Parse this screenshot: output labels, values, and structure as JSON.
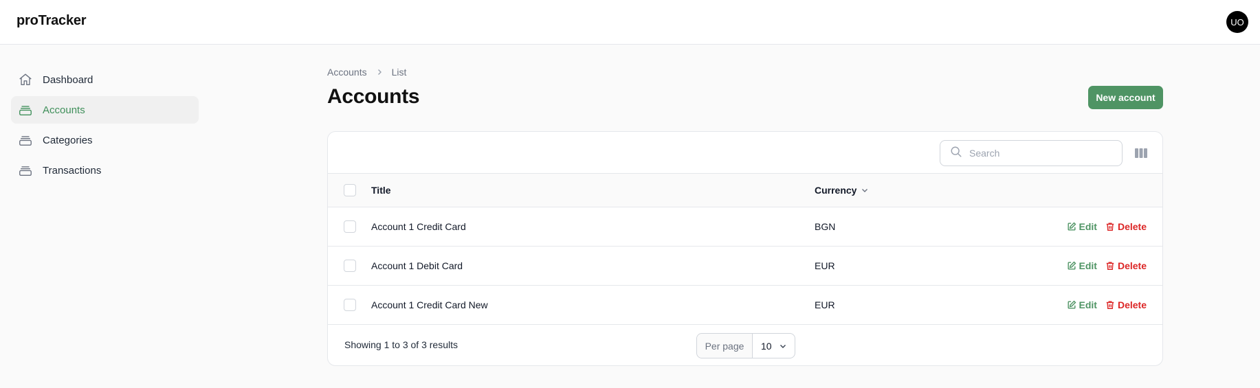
{
  "app": {
    "brand": "proTracker",
    "avatar_initials": "UO"
  },
  "sidebar": {
    "items": [
      {
        "label": "Dashboard",
        "icon": "home-icon",
        "active": false
      },
      {
        "label": "Accounts",
        "icon": "stack-icon",
        "active": true
      },
      {
        "label": "Categories",
        "icon": "stack-icon",
        "active": false
      },
      {
        "label": "Transactions",
        "icon": "stack-icon",
        "active": false
      }
    ]
  },
  "breadcrumb": {
    "items": [
      "Accounts",
      "List"
    ]
  },
  "page": {
    "title": "Accounts",
    "new_button": "New account"
  },
  "table": {
    "search_placeholder": "Search",
    "columns": {
      "title": "Title",
      "currency": "Currency"
    },
    "rows": [
      {
        "title": "Account 1 Credit Card",
        "currency": "BGN",
        "edit": "Edit",
        "delete": "Delete"
      },
      {
        "title": "Account 1 Debit Card",
        "currency": "EUR",
        "edit": "Edit",
        "delete": "Delete"
      },
      {
        "title": "Account 1 Credit Card New",
        "currency": "EUR",
        "edit": "Edit",
        "delete": "Delete"
      }
    ],
    "showing": "Showing 1 to 3 of 3 results",
    "per_page_label": "Per page",
    "per_page_value": "10"
  },
  "colors": {
    "accent": "#4f9464",
    "danger": "#dc2626",
    "active_nav": "#3f8f5a"
  }
}
